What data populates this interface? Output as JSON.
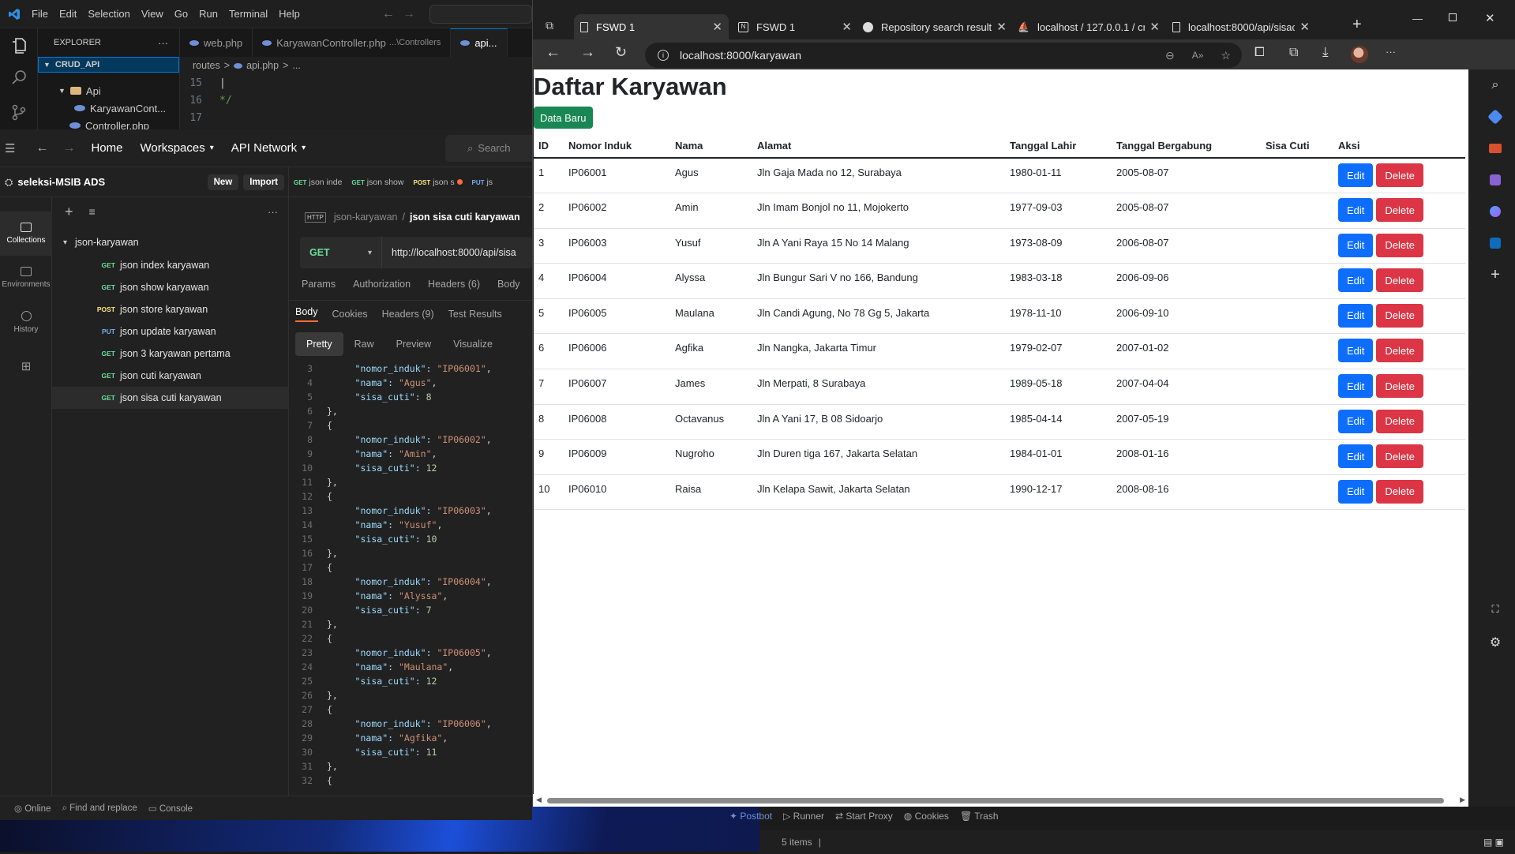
{
  "vscode": {
    "menu": [
      "File",
      "Edit",
      "Selection",
      "View",
      "Go",
      "Run",
      "Terminal",
      "Help"
    ],
    "explorer_title": "EXPLORER",
    "project": "CRUD_API",
    "tree": [
      "Api",
      "KaryawanCont...",
      "Controller.php"
    ],
    "tabs": [
      "web.php",
      "KaryawanController.php",
      "...\\Controllers",
      "api..."
    ],
    "breadcrumb": [
      "routes",
      ">",
      "api.php",
      ">",
      "..."
    ],
    "lines": [
      {
        "n": "15",
        "t": "|"
      },
      {
        "n": "16",
        "t": "*/"
      },
      {
        "n": "17",
        "t": ""
      }
    ]
  },
  "postman": {
    "nav": {
      "home": "Home",
      "workspaces": "Workspaces",
      "api_network": "API Network",
      "search": "Search"
    },
    "workspace": "seleksi-MSIB ADS",
    "new_label": "New",
    "import_label": "Import",
    "open_tabs": [
      {
        "method": "GET",
        "name": "json inde"
      },
      {
        "method": "GET",
        "name": "json show"
      },
      {
        "method": "POST",
        "name": "json s"
      },
      {
        "method": "PUT",
        "name": "js"
      }
    ],
    "rail": [
      "Collections",
      "Environments",
      "History"
    ],
    "collection": "json-karyawan",
    "requests": [
      {
        "method": "GET",
        "name": "json index karyawan"
      },
      {
        "method": "GET",
        "name": "json show karyawan"
      },
      {
        "method": "POST",
        "name": "json store karyawan"
      },
      {
        "method": "PUT",
        "name": "json update karyawan"
      },
      {
        "method": "GET",
        "name": "json 3 karyawan pertama"
      },
      {
        "method": "GET",
        "name": "json cuti karyawan"
      },
      {
        "method": "GET",
        "name": "json sisa cuti karyawan"
      }
    ],
    "request_crumb": "json-karyawan",
    "request_title": "json sisa cuti karyawan",
    "method": "GET",
    "url": "http://localhost:8000/api/sisa",
    "req_tabs": [
      "Params",
      "Authorization",
      "Headers (6)",
      "Body"
    ],
    "resp_tabs": [
      "Body",
      "Cookies",
      "Headers (9)",
      "Test Results"
    ],
    "view_tabs": [
      "Pretty",
      "Raw",
      "Preview",
      "Visualize"
    ],
    "code": [
      {
        "n": "3",
        "k": "nomor_induk",
        "v": "\"IP06001\"",
        "type": "str"
      },
      {
        "n": "4",
        "k": "nama",
        "v": "\"Agus\"",
        "type": "str"
      },
      {
        "n": "5",
        "k": "sisa_cuti",
        "v": "8",
        "type": "num"
      },
      {
        "n": "6",
        "p": "},"
      },
      {
        "n": "7",
        "p": "{"
      },
      {
        "n": "8",
        "k": "nomor_induk",
        "v": "\"IP06002\"",
        "type": "str"
      },
      {
        "n": "9",
        "k": "nama",
        "v": "\"Amin\"",
        "type": "str"
      },
      {
        "n": "10",
        "k": "sisa_cuti",
        "v": "12",
        "type": "num"
      },
      {
        "n": "11",
        "p": "},"
      },
      {
        "n": "12",
        "p": "{"
      },
      {
        "n": "13",
        "k": "nomor_induk",
        "v": "\"IP06003\"",
        "type": "str"
      },
      {
        "n": "14",
        "k": "nama",
        "v": "\"Yusuf\"",
        "type": "str"
      },
      {
        "n": "15",
        "k": "sisa_cuti",
        "v": "10",
        "type": "num"
      },
      {
        "n": "16",
        "p": "},"
      },
      {
        "n": "17",
        "p": "{"
      },
      {
        "n": "18",
        "k": "nomor_induk",
        "v": "\"IP06004\"",
        "type": "str"
      },
      {
        "n": "19",
        "k": "nama",
        "v": "\"Alyssa\"",
        "type": "str"
      },
      {
        "n": "20",
        "k": "sisa_cuti",
        "v": "7",
        "type": "num"
      },
      {
        "n": "21",
        "p": "},"
      },
      {
        "n": "22",
        "p": "{"
      },
      {
        "n": "23",
        "k": "nomor_induk",
        "v": "\"IP06005\"",
        "type": "str"
      },
      {
        "n": "24",
        "k": "nama",
        "v": "\"Maulana\"",
        "type": "str"
      },
      {
        "n": "25",
        "k": "sisa_cuti",
        "v": "12",
        "type": "num"
      },
      {
        "n": "26",
        "p": "},"
      },
      {
        "n": "27",
        "p": "{"
      },
      {
        "n": "28",
        "k": "nomor_induk",
        "v": "\"IP06006\"",
        "type": "str"
      },
      {
        "n": "29",
        "k": "nama",
        "v": "\"Agfika\"",
        "type": "str"
      },
      {
        "n": "30",
        "k": "sisa_cuti",
        "v": "11",
        "type": "num"
      },
      {
        "n": "31",
        "p": "},"
      },
      {
        "n": "32",
        "p": "{"
      }
    ],
    "status": [
      "Online",
      "Find and replace",
      "Console"
    ],
    "bottom_tools": [
      "Postbot",
      "Runner",
      "Start Proxy",
      "Cookies",
      "Trash"
    ]
  },
  "edge": {
    "tabs": [
      {
        "title": "FSWD 1",
        "active": true
      },
      {
        "title": "FSWD 1",
        "active": false
      },
      {
        "title": "Repository search result",
        "active": false
      },
      {
        "title": "localhost / 127.0.0.1 / cr",
        "active": false
      },
      {
        "title": "localhost:8000/api/sisac",
        "active": false
      }
    ],
    "address": "localhost:8000/karyawan"
  },
  "page": {
    "title": "Daftar Karyawan",
    "new_button": "Data Baru",
    "columns": [
      "ID",
      "Nomor Induk",
      "Nama",
      "Alamat",
      "Tanggal Lahir",
      "Tanggal Bergabung",
      "Sisa Cuti",
      "Aksi"
    ],
    "edit_label": "Edit",
    "delete_label": "Delete",
    "rows": [
      [
        "1",
        "IP06001",
        "Agus",
        "Jln Gaja Mada no 12, Surabaya",
        "1980-01-11",
        "2005-08-07",
        ""
      ],
      [
        "2",
        "IP06002",
        "Amin",
        "Jln Imam Bonjol no 11, Mojokerto",
        "1977-09-03",
        "2005-08-07",
        ""
      ],
      [
        "3",
        "IP06003",
        "Yusuf",
        "Jln A Yani Raya 15 No 14 Malang",
        "1973-08-09",
        "2006-08-07",
        ""
      ],
      [
        "4",
        "IP06004",
        "Alyssa",
        "Jln Bungur Sari V no 166, Bandung",
        "1983-03-18",
        "2006-09-06",
        ""
      ],
      [
        "5",
        "IP06005",
        "Maulana",
        "Jln Candi Agung, No 78 Gg 5, Jakarta",
        "1978-11-10",
        "2006-09-10",
        ""
      ],
      [
        "6",
        "IP06006",
        "Agfika",
        "Jln Nangka, Jakarta Timur",
        "1979-02-07",
        "2007-01-02",
        ""
      ],
      [
        "7",
        "IP06007",
        "James",
        "Jln Merpati, 8 Surabaya",
        "1989-05-18",
        "2007-04-04",
        ""
      ],
      [
        "8",
        "IP06008",
        "Octavanus",
        "Jln A Yani 17, B 08 Sidoarjo",
        "1985-04-14",
        "2007-05-19",
        ""
      ],
      [
        "9",
        "IP06009",
        "Nugroho",
        "Jln Duren tiga 167, Jakarta Selatan",
        "1984-01-01",
        "2008-01-16",
        ""
      ],
      [
        "10",
        "IP06010",
        "Raisa",
        "Jln Kelapa Sawit, Jakarta Selatan",
        "1990-12-17",
        "2008-08-16",
        ""
      ]
    ]
  },
  "footer": {
    "items": "5 items"
  },
  "colors": {
    "success": "#198754",
    "primary": "#0d6efd",
    "danger": "#dc3545",
    "vscode_accent": "#0078d4",
    "postman_get": "#6bdd9a",
    "postman_post": "#ffe47e",
    "postman_put": "#74aef6"
  }
}
